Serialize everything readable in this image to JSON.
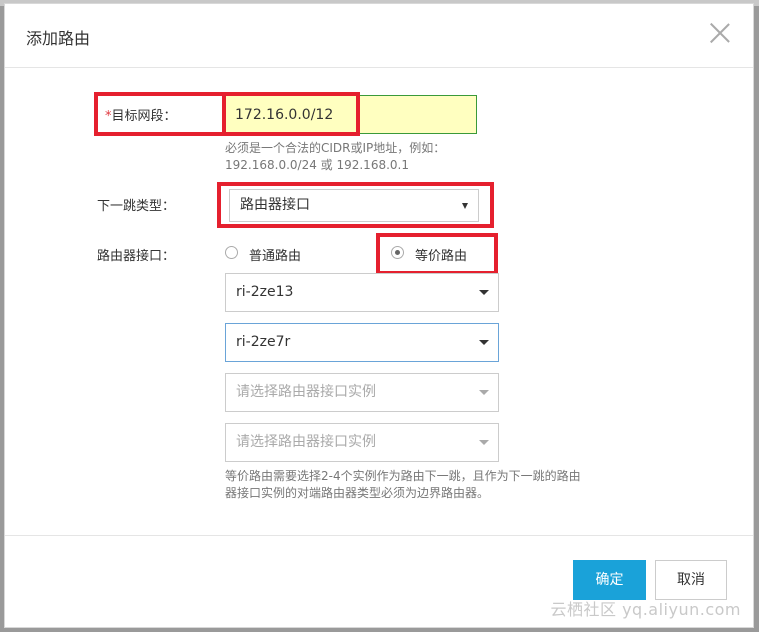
{
  "dialog": {
    "title": "添加路由",
    "close_icon": "close-icon"
  },
  "form": {
    "cidr": {
      "required_mark": "*",
      "label": "目标网段：",
      "value": "172.16.0.0/12",
      "hint_line1": "必须是一个合法的CIDR或IP地址，例如：",
      "hint_line2": "192.168.0.0/24 或 192.168.0.1"
    },
    "next_hop": {
      "label": "下一跳类型：",
      "selected": "路由器接口"
    },
    "router_interface": {
      "label": "路由器接口：",
      "radio_normal": "普通路由",
      "radio_ecmp": "等价路由",
      "selected_radio": "等价路由",
      "selects": [
        {
          "value": "ri-2ze13"
        },
        {
          "value": "ri-2ze7r"
        },
        {
          "placeholder": "请选择路由器接口实例"
        },
        {
          "placeholder": "请选择路由器接口实例"
        }
      ],
      "note_line1": "等价路由需要选择2-4个实例作为路由下一跳，且作为下一跳的路由",
      "note_line2": "器接口实例的对端路由器类型必须为边界路由器。"
    }
  },
  "footer": {
    "ok_label": "确定",
    "cancel_label": "取消"
  },
  "watermark": "云栖社区 yq.aliyun.com",
  "colors": {
    "primary": "#1aa2d9",
    "highlight_box": "#e5202e",
    "input_highlight_bg": "#ffffc0"
  }
}
